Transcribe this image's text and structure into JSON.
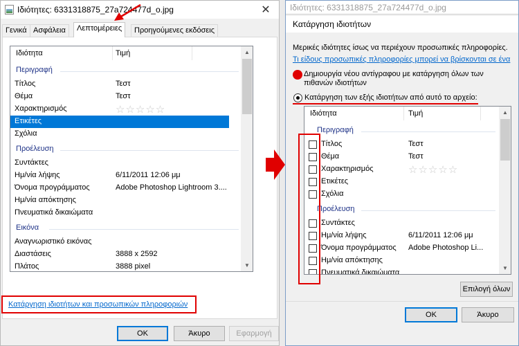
{
  "left_dialog": {
    "title": "Ιδιότητες: 6331318875_27a724477d_o.jpg",
    "tabs": [
      "Γενικά",
      "Ασφάλεια",
      "Λεπτομέρειες",
      "Προηγούμενες εκδόσεις"
    ],
    "active_tab": "Λεπτομέρειες",
    "columns": {
      "property": "Ιδιότητα",
      "value": "Τιμή"
    },
    "groups": {
      "description": "Περιγραφή",
      "origin": "Προέλευση",
      "image": "Εικόνα"
    },
    "rows": {
      "title": {
        "label": "Τίτλος",
        "value": "Τεστ"
      },
      "subject": {
        "label": "Θέμα",
        "value": "Τεστ"
      },
      "rating": {
        "label": "Χαρακτηρισμός",
        "value": "☆☆☆☆☆"
      },
      "tags": {
        "label": "Ετικέτες",
        "value": ""
      },
      "comments": {
        "label": "Σχόλια",
        "value": ""
      },
      "authors": {
        "label": "Συντάκτες",
        "value": ""
      },
      "date_taken": {
        "label": "Ημ/νία λήψης",
        "value": "6/11/2011 12:06 μμ"
      },
      "program": {
        "label": "Όνομα προγράμματος",
        "value": "Adobe Photoshop Lightroom 3...."
      },
      "acquired": {
        "label": "Ημ/νία απόκτησης",
        "value": ""
      },
      "copyright": {
        "label": "Πνευματικά δικαιώματα",
        "value": ""
      },
      "image_id": {
        "label": "Αναγνωριστικό εικόνας",
        "value": ""
      },
      "dimensions": {
        "label": "Διαστάσεις",
        "value": "3888 x 2592"
      },
      "width": {
        "label": "Πλάτος",
        "value": "3888 pixel"
      }
    },
    "remove_link": "Κατάργηση ιδιοτήτων και προσωπικών πληροφοριών",
    "buttons": {
      "ok": "OK",
      "cancel": "Άκυρο",
      "apply": "Εφαρμογή"
    }
  },
  "right_dialog": {
    "bg_title": "Ιδιότητες: 6331318875_27a724477d_o.jpg",
    "title": "Κατάργηση ιδιοτήτων",
    "intro": "Μερικές ιδιότητες ίσως να περιέχουν προσωπικές πληροφορίες.",
    "info_link": "Τι είδους προσωπικές πληροφορίες μπορεί να βρίσκονται σε ένα",
    "option_copy_line1": "Δημιουργία νέου αντίγραφου με κατάργηση όλων των",
    "option_copy_line2": "πιθανών ιδιοτήτων",
    "option_remove": "Κατάργηση των εξής ιδιοτήτων από αυτό το αρχείο:",
    "columns": {
      "property": "Ιδιότητα",
      "value": "Τιμή"
    },
    "groups": {
      "description": "Περιγραφή",
      "origin": "Προέλευση"
    },
    "rows": {
      "title": {
        "label": "Τίτλος",
        "value": "Τεστ"
      },
      "subject": {
        "label": "Θέμα",
        "value": "Τεστ"
      },
      "rating": {
        "label": "Χαρακτηρισμός",
        "value": "☆☆☆☆☆"
      },
      "tags": {
        "label": "Ετικέτες",
        "value": ""
      },
      "comments": {
        "label": "Σχόλια",
        "value": ""
      },
      "authors": {
        "label": "Συντάκτες",
        "value": ""
      },
      "date_taken": {
        "label": "Ημ/νία λήψης",
        "value": "6/11/2011 12:06 μμ"
      },
      "program": {
        "label": "Όνομα προγράμματος",
        "value": "Adobe Photoshop Li..."
      },
      "acquired": {
        "label": "Ημ/νία απόκτησης",
        "value": ""
      },
      "copyright": {
        "label": "Πνευματικά δικαιώματα",
        "value": ""
      }
    },
    "select_all": "Επιλογή όλων",
    "buttons": {
      "ok": "OK",
      "cancel": "Άκυρο"
    }
  },
  "colors": {
    "annotation_red": "#e00000",
    "selection_blue": "#0078d7",
    "link_blue": "#0066cc"
  }
}
